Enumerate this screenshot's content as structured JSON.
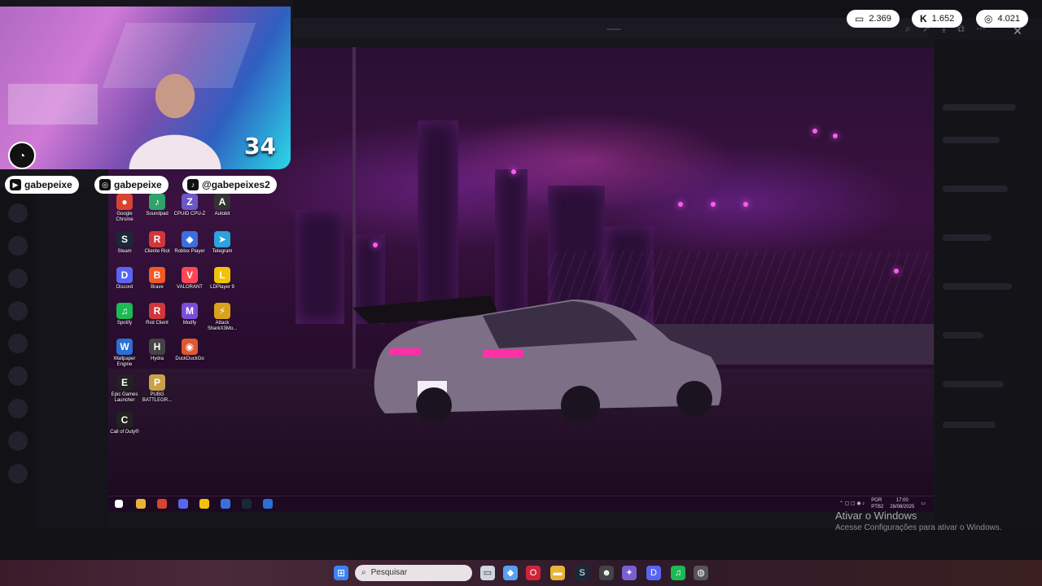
{
  "stream": {
    "socials": [
      {
        "platform_icon": "youtube-icon",
        "handle": "gabepeixe"
      },
      {
        "platform_icon": "instagram-icon",
        "handle": "gabepeixe"
      },
      {
        "platform_icon": "tiktok-icon",
        "handle": "@gabepeixes2"
      }
    ],
    "stats": [
      {
        "icon": "twitch-icon",
        "glyph": "▭",
        "value": "2.369"
      },
      {
        "icon": "kick-icon",
        "glyph": "K",
        "value": "1.652"
      },
      {
        "icon": "globe-icon",
        "glyph": "◎",
        "value": "4.021"
      }
    ],
    "cam_number": "34"
  },
  "desktop": {
    "icons": [
      {
        "label": "Google Chrome",
        "color": "#d9432f",
        "glyph": "●"
      },
      {
        "label": "Soundpad",
        "color": "#2fa36a",
        "glyph": "♪"
      },
      {
        "label": "CPUID CPU-Z",
        "color": "#6c57c7",
        "glyph": "Z"
      },
      {
        "label": "Autobit",
        "color": "#333333",
        "glyph": "A"
      },
      {
        "label": "Steam",
        "color": "#1b2838",
        "glyph": "S"
      },
      {
        "label": "Cliente Riot",
        "color": "#d13639",
        "glyph": "R"
      },
      {
        "label": "Roblox Player",
        "color": "#3b6fe0",
        "glyph": "◆"
      },
      {
        "label": "Telegram",
        "color": "#2aa3de",
        "glyph": "➤"
      },
      {
        "label": "Discord",
        "color": "#5865f2",
        "glyph": "D"
      },
      {
        "label": "Brave",
        "color": "#f15a24",
        "glyph": "B"
      },
      {
        "label": "VALORANT",
        "color": "#ff4655",
        "glyph": "V"
      },
      {
        "label": "LDPlayer 9",
        "color": "#f2c20a",
        "glyph": "L"
      },
      {
        "label": "Spotify",
        "color": "#1db954",
        "glyph": "♫"
      },
      {
        "label": "Riot Client",
        "color": "#d13639",
        "glyph": "R"
      },
      {
        "label": "Modfy",
        "color": "#7b4ddb",
        "glyph": "M"
      },
      {
        "label": "Attack SharkX3Mo...",
        "color": "#d9a21a",
        "glyph": "⚡"
      },
      {
        "label": "Wallpaper Engine",
        "color": "#2a6fd6",
        "glyph": "W"
      },
      {
        "label": "Hydra",
        "color": "#444444",
        "glyph": "H"
      },
      {
        "label": "DuckDuckGo",
        "color": "#de5833",
        "glyph": "◉"
      },
      {
        "label": "Epic Games Launcher",
        "color": "#222222",
        "glyph": "E"
      },
      {
        "label": "PUBG BATTLEGR...",
        "color": "#c9a14a",
        "glyph": "P"
      },
      {
        "label": "Call of Duty®",
        "color": "#222222",
        "glyph": "C"
      }
    ],
    "tray": {
      "lang_top": "POR",
      "lang_bottom": "PTB2",
      "time": "17:00",
      "date": "28/08/2025"
    }
  },
  "activation": {
    "title": "Ativar o Windows",
    "subtitle": "Acesse Configurações para ativar o Windows."
  },
  "host_taskbar": {
    "search_placeholder": "Pesquisar"
  }
}
